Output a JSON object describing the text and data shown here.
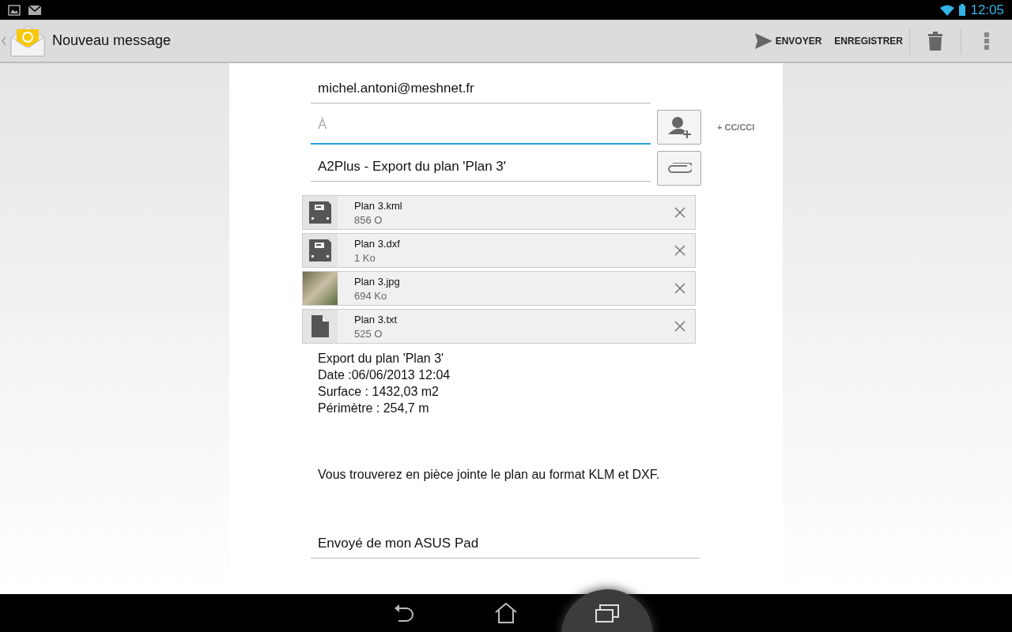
{
  "status_bar": {
    "time": "12:05"
  },
  "action_bar": {
    "title": "Nouveau message",
    "actions": [
      {
        "kind": "send",
        "label": "ENVOYER"
      },
      {
        "kind": "text",
        "label": "ENREGISTRER"
      },
      {
        "kind": "trash"
      },
      {
        "kind": "overflow"
      }
    ]
  },
  "from": "michel.antoni@meshnet.fr",
  "to": {
    "placeholder": "À"
  },
  "cc_link": "+ CC/CCI",
  "subject": "A2Plus - Export du plan 'Plan 3'",
  "attachments": [
    {
      "kind": "file",
      "name": "Plan 3.kml",
      "size": "856 O"
    },
    {
      "kind": "file",
      "name": "Plan 3.dxf",
      "size": "1 Ko"
    },
    {
      "kind": "image",
      "name": "Plan 3.jpg",
      "size": "694 Ko"
    },
    {
      "kind": "doc",
      "name": "Plan 3.txt",
      "size": "525 O"
    }
  ],
  "body": [
    "Export du plan 'Plan 3'",
    "Date :06/06/2013 12:04",
    "Surface : 1432,03 m2",
    "Périmètre : 254,7 m"
  ],
  "body_message": "Vous trouverez en pièce jointe le plan au format KLM et DXF.",
  "signature": "Envoyé de mon ASUS Pad",
  "nav": [
    {
      "kind": "back",
      "selected": false
    },
    {
      "kind": "home",
      "selected": false
    },
    {
      "kind": "recents",
      "selected": true
    }
  ]
}
